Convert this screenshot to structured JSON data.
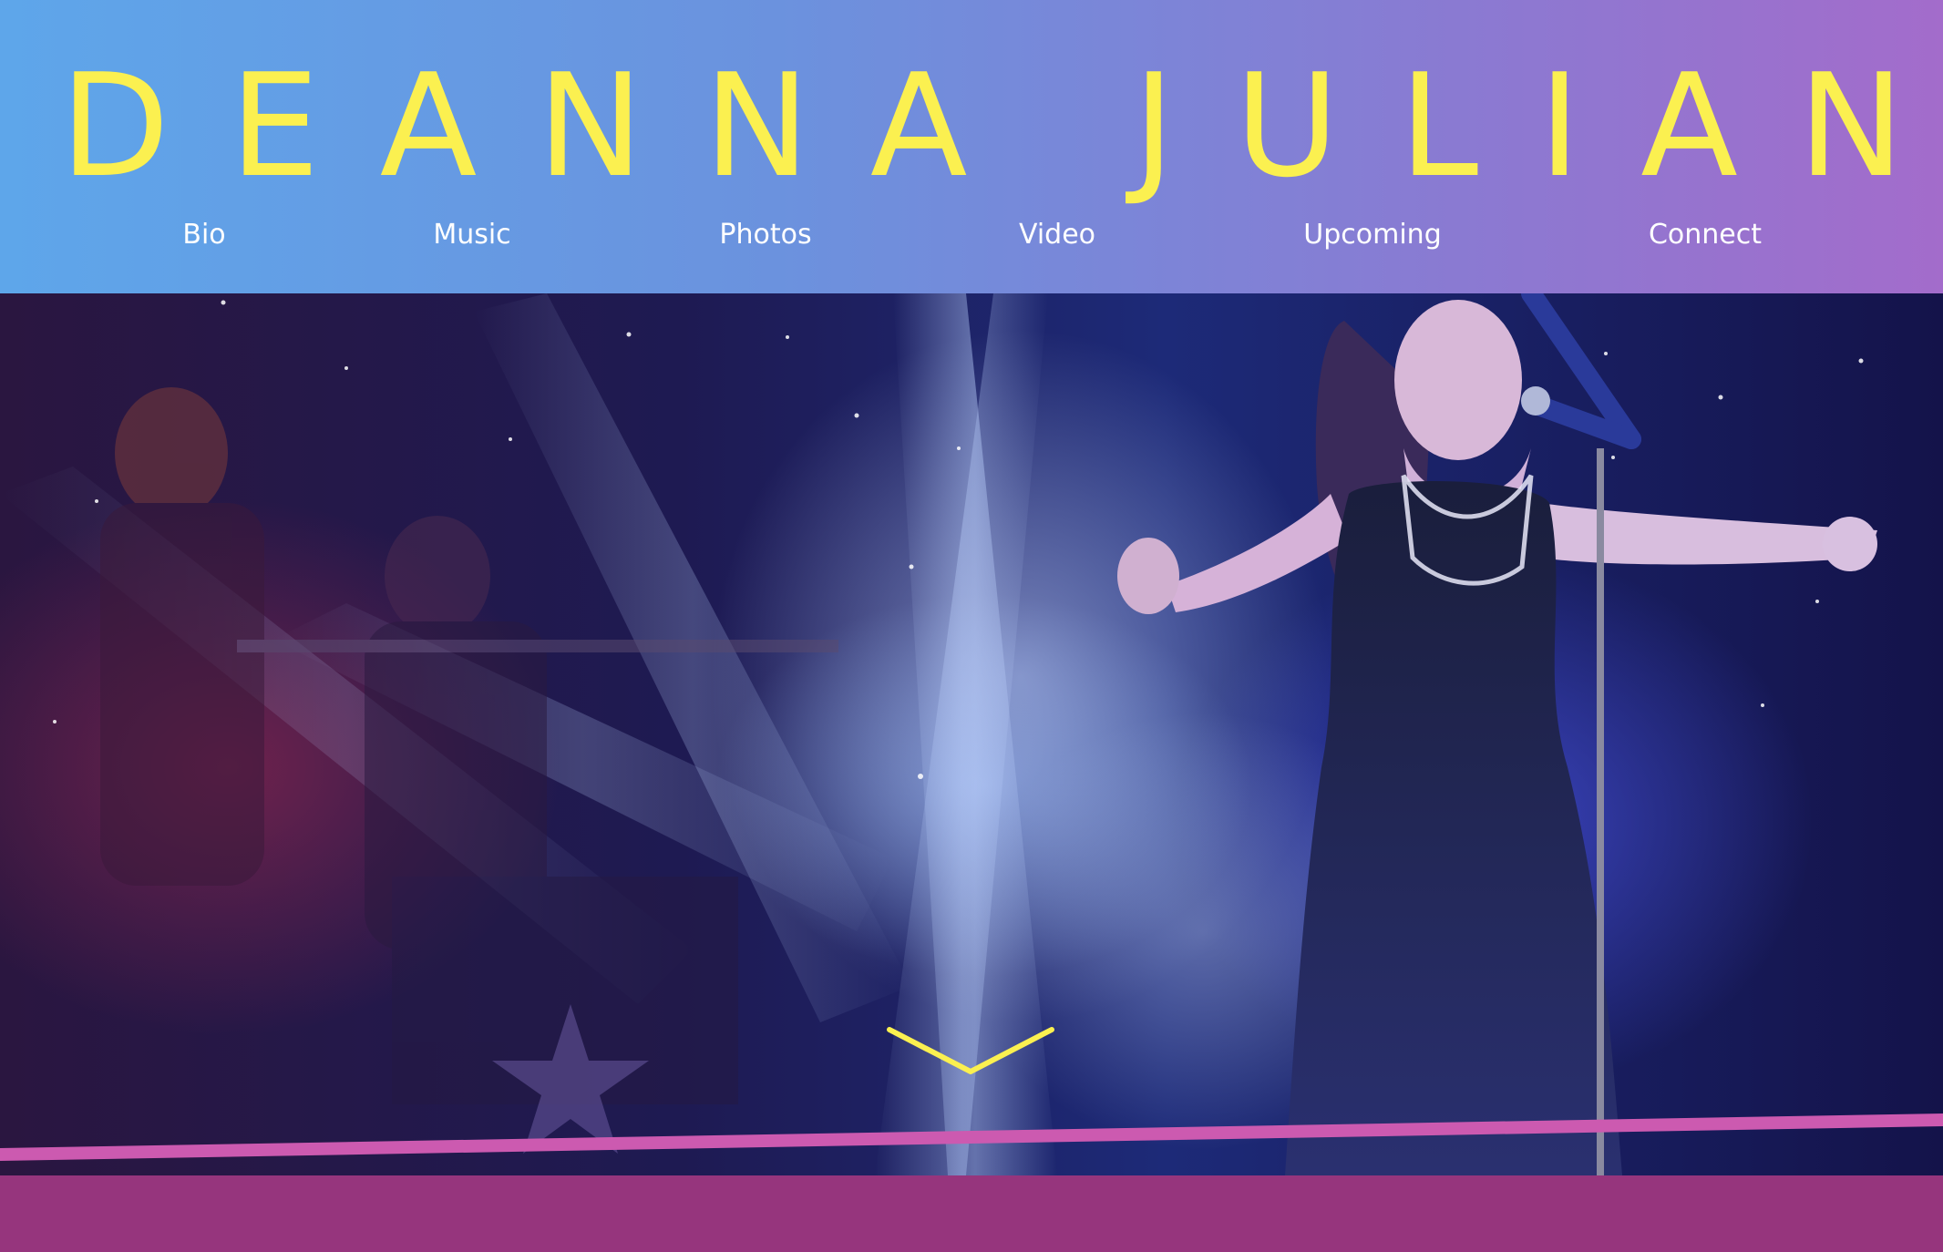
{
  "site": {
    "title": "DEANNA JULIAN"
  },
  "nav": {
    "items": [
      {
        "label": "Bio"
      },
      {
        "label": "Music"
      },
      {
        "label": "Photos"
      },
      {
        "label": "Video"
      },
      {
        "label": "Upcoming"
      },
      {
        "label": "Connect"
      }
    ]
  },
  "hero": {
    "scroll_icon": "chevron-down-icon"
  },
  "colors": {
    "title": "#fbf050",
    "nav_text": "#ffffff",
    "header_gradient_start": "#5ea6ea",
    "header_gradient_end": "#a36ccb",
    "accent_line": "#cc5ab0",
    "footer": "#96357d",
    "chevron": "#fbf050"
  }
}
